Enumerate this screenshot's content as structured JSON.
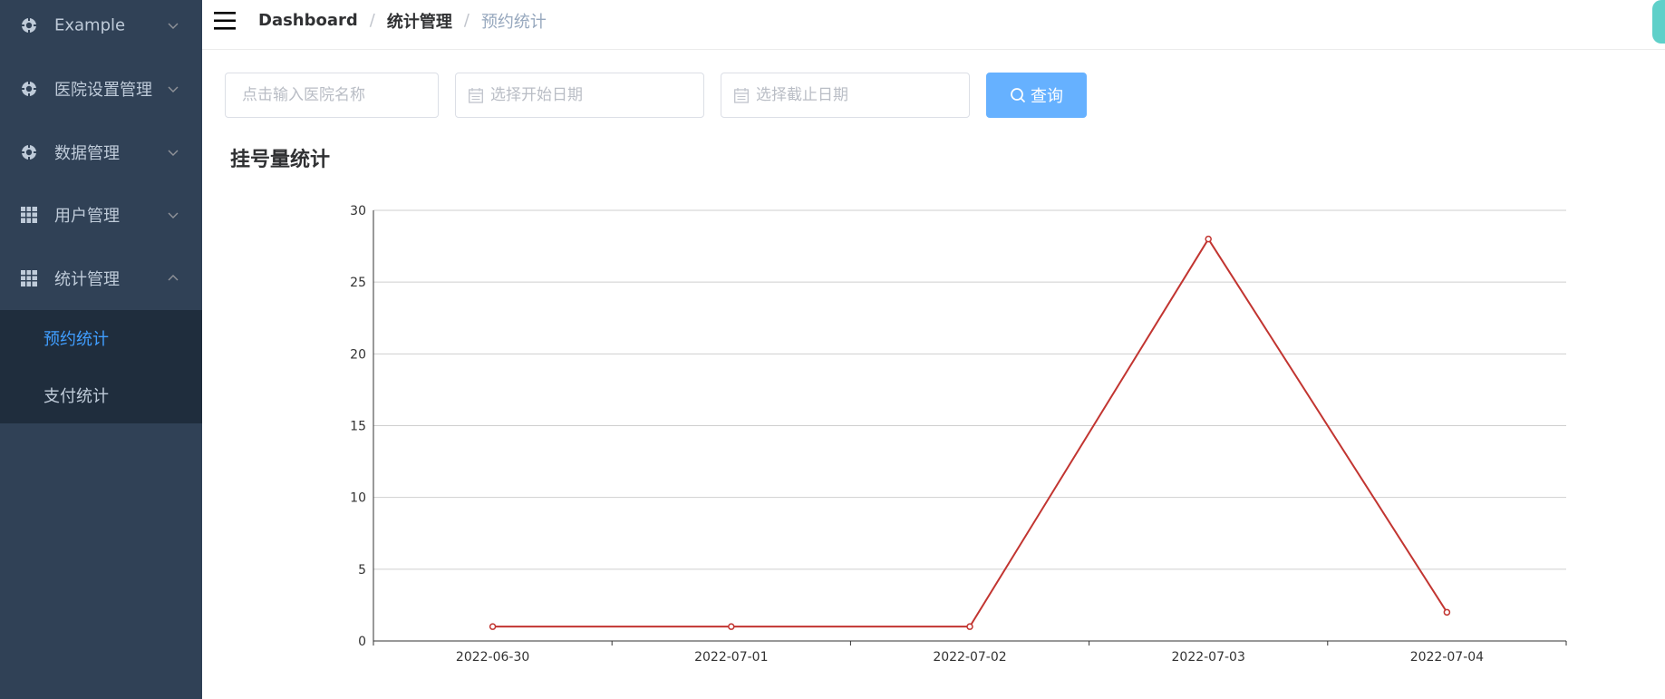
{
  "sidebar": {
    "items": [
      {
        "label": "Example",
        "icon": "gear-icon",
        "expanded": false
      },
      {
        "label": "医院设置管理",
        "icon": "gear-icon",
        "expanded": false
      },
      {
        "label": "数据管理",
        "icon": "gear-icon",
        "expanded": false
      },
      {
        "label": "用户管理",
        "icon": "table-icon",
        "expanded": false
      },
      {
        "label": "统计管理",
        "icon": "table-icon",
        "expanded": true
      }
    ],
    "submenu": [
      {
        "label": "预约统计",
        "active": true
      },
      {
        "label": "支付统计",
        "active": false
      }
    ]
  },
  "navbar": {
    "breadcrumb": [
      "Dashboard",
      "统计管理",
      "预约统计"
    ]
  },
  "filters": {
    "hospital_placeholder": "点击输入医院名称",
    "start_date_placeholder": "选择开始日期",
    "end_date_placeholder": "选择截止日期",
    "query_label": "查询"
  },
  "chart_title": "挂号量统计",
  "chart_data": {
    "type": "line",
    "categories": [
      "2022-06-30",
      "2022-07-01",
      "2022-07-02",
      "2022-07-03",
      "2022-07-04"
    ],
    "series": [
      {
        "values": [
          1,
          1,
          1,
          28,
          2
        ]
      }
    ],
    "ylim": [
      0,
      30
    ],
    "yticks": [
      0,
      5,
      10,
      15,
      20,
      25,
      30
    ],
    "grid": true,
    "line_color": "#c23531"
  },
  "colors": {
    "sidebar_bg": "#304156",
    "submenu_bg": "#1f2d3d",
    "active": "#409eff",
    "button": "#66b1ff"
  }
}
